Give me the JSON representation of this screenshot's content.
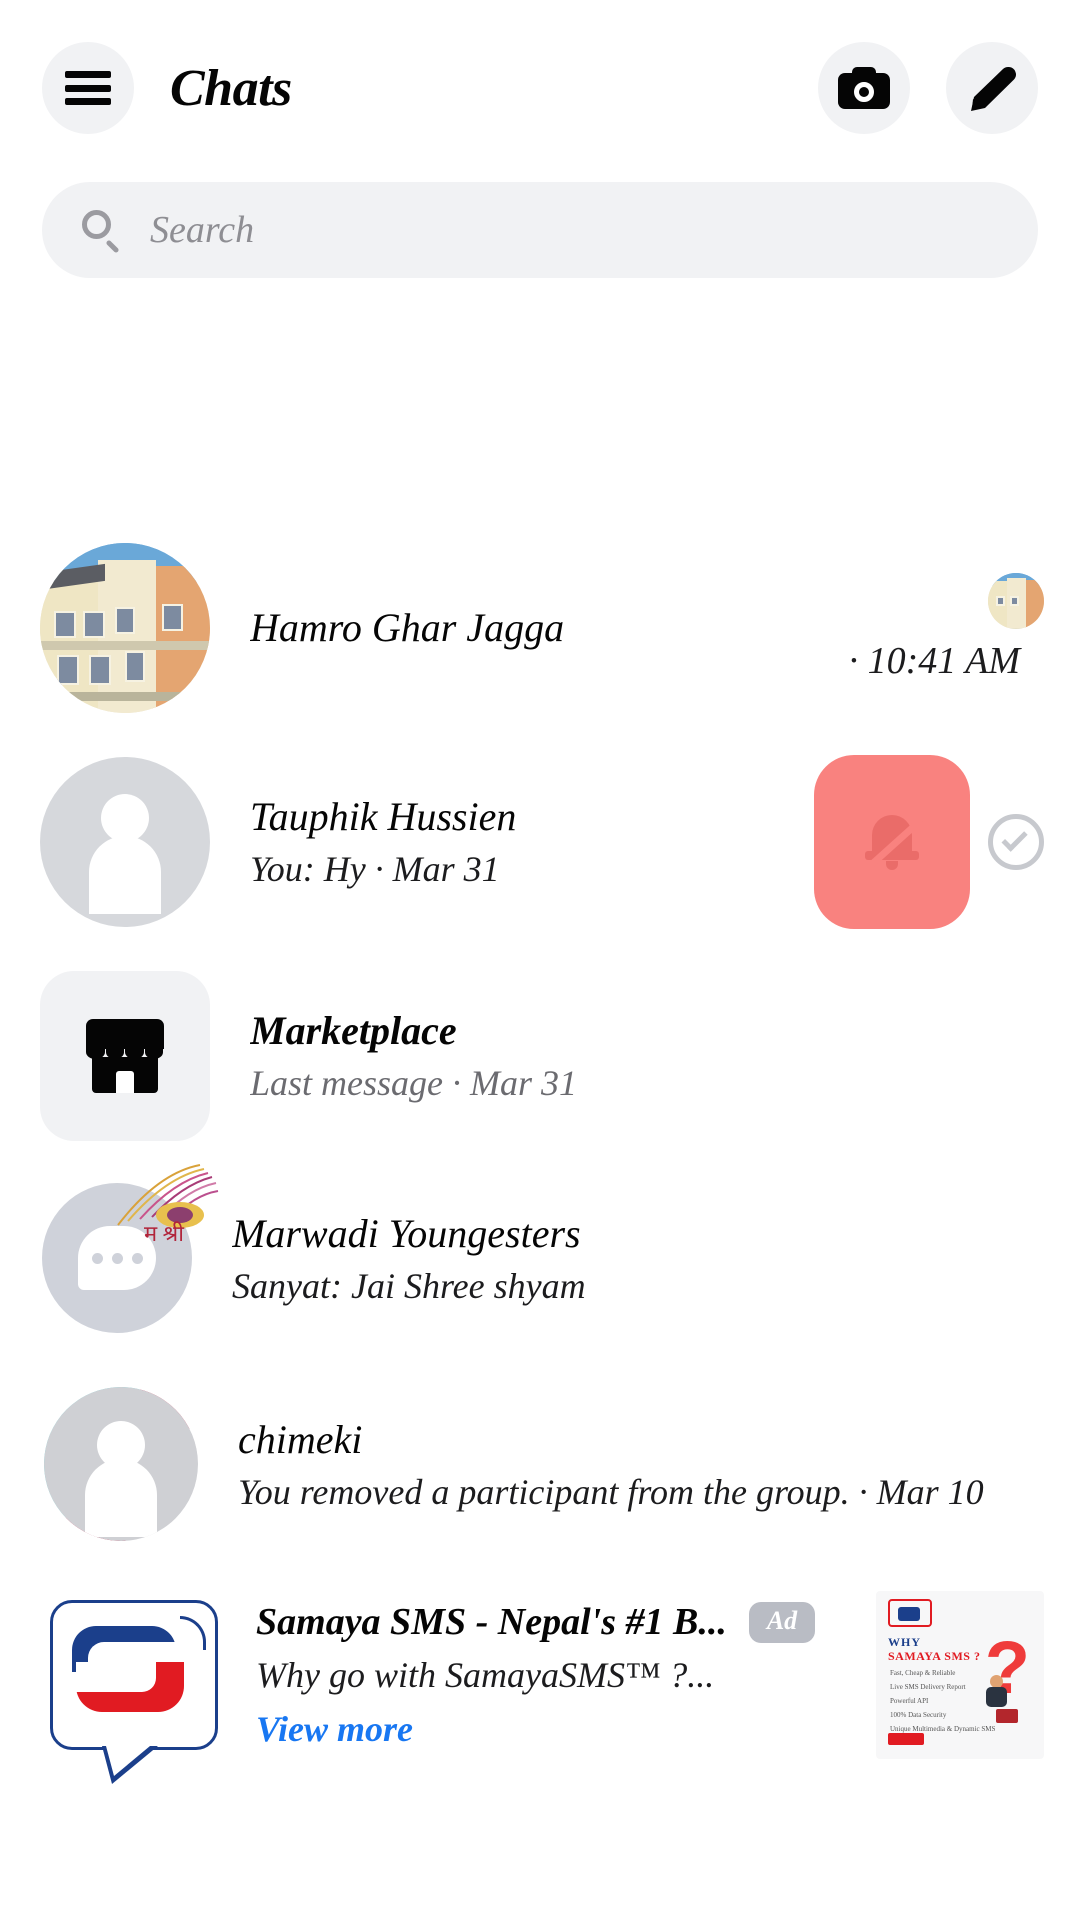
{
  "header": {
    "title": "Chats",
    "menu_icon": "hamburger-menu-icon",
    "camera_icon": "camera-icon",
    "compose_icon": "pencil-compose-icon"
  },
  "search": {
    "placeholder": "Search",
    "value": "",
    "icon": "search-icon"
  },
  "colors": {
    "accent_link": "#1877f2",
    "mute_button_bg": "#f9827f",
    "chip_bg": "#b9bcc4",
    "surface": "#f1f2f4",
    "text_primary": "#050505",
    "text_secondary": "#6b6b70"
  },
  "chats": [
    {
      "name": "Hamro Ghar Jagga",
      "snippet": "",
      "timestamp": "· 10:41 AM",
      "unread": false,
      "avatar_type": "photo-building",
      "read_receipt": "read-receipt-thumbnail",
      "has_mute_action": false
    },
    {
      "name": "Tauphik Hussien",
      "snippet": "You: Hy · Mar 31",
      "timestamp": "",
      "unread": false,
      "avatar_type": "default-person",
      "has_mute_action": true,
      "mute_icon": "bell-slash-icon",
      "select_icon": "check-circle-icon"
    },
    {
      "name": "Marketplace",
      "snippet": "Last message · Mar 31",
      "timestamp": "",
      "unread": true,
      "avatar_type": "marketplace-tile",
      "has_mute_action": false
    },
    {
      "name": "Marwadi Youngesters",
      "snippet": "Sanyat: Jai Shree shyam",
      "timestamp": "",
      "unread": false,
      "avatar_type": "bubble-placeholder",
      "has_mute_action": false
    },
    {
      "name": "chimeki",
      "snippet": "You removed a participant from the group. · Mar 10",
      "timestamp": "",
      "unread": false,
      "avatar_type": "default-person",
      "has_mute_action": false
    }
  ],
  "ad": {
    "title": "Samaya SMS - Nepal's #1 B...",
    "badge": "Ad",
    "subtitle": "Why go with SamayaSMS™ ?...",
    "cta": "View more",
    "thumbnail": {
      "heading_line1": "WHY",
      "heading_line2": "SAMAYA SMS ?",
      "bullets": [
        "Fast, Cheap & Reliable",
        "Live SMS Delivery Report",
        "Powerful API",
        "100% Data Security",
        "Unique Multimedia & Dynamic SMS"
      ],
      "question_mark": "?"
    }
  }
}
